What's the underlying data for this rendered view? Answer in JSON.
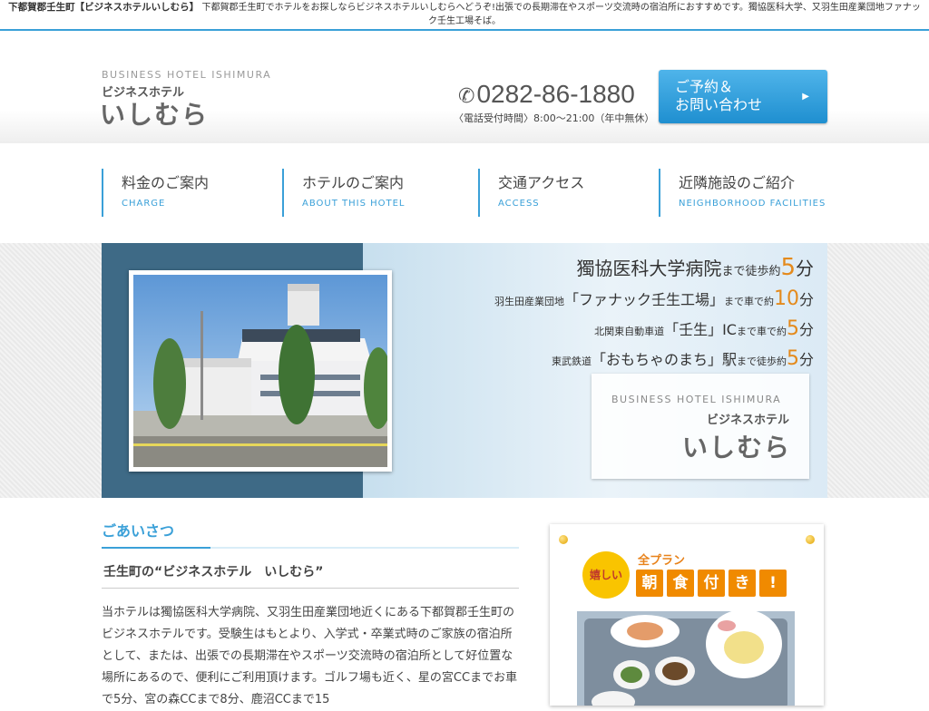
{
  "topbar": {
    "title": "下都賀郡壬生町【ビジネスホテルいしむら】",
    "description": "下都賀郡壬生町でホテルをお探しならビジネスホテルいしむらへどうぞ!出張での長期滞在やスポーツ交流時の宿泊所におすすめです。獨協医科大学、又羽生田産業団地ファナック壬生工場そば。"
  },
  "header": {
    "logo_en": "BUSINESS HOTEL ISHIMURA",
    "logo_jp_small": "ビジネスホテル",
    "logo_jp_big": "いしむら",
    "phone": "0282-86-1880",
    "phone_hours": "〈電話受付時間〉8:00〜21:00（年中無休）",
    "contact_line1": "ご予約＆",
    "contact_line2": "お問い合わせ"
  },
  "nav": {
    "items": [
      {
        "jp": "料金のご案内",
        "en": "CHARGE"
      },
      {
        "jp": "ホテルのご案内",
        "en": "ABOUT THIS HOTEL"
      },
      {
        "jp": "交通アクセス",
        "en": "ACCESS"
      },
      {
        "jp": "近隣施設のご紹介",
        "en": "NEIGHBORHOOD FACILITIES"
      }
    ]
  },
  "hero": {
    "line1_text": "獨協医科大学病院",
    "line1_suffix": "まで徒歩約",
    "line1_num": "5",
    "line1_unit": "分",
    "line2_prefix": "羽生田産業団地",
    "line2_text": "「ファナック壬生工場」",
    "line2_suffix": "まで車で約",
    "line2_num": "10",
    "line2_unit": "分",
    "line3_prefix": "北関東自動車道",
    "line3_text": "「壬生」IC",
    "line3_suffix": "まで車で約",
    "line3_num": "5",
    "line3_unit": "分",
    "line4_prefix": "東武鉄道",
    "line4_text": "「おもちゃのまち」駅",
    "line4_suffix": "まで徒歩約",
    "line4_num": "5",
    "line4_unit": "分",
    "logo_en": "BUSINESS HOTEL ISHIMURA",
    "logo_jp_small": "ビジネスホテル",
    "logo_jp_big": "いしむら"
  },
  "greeting": {
    "title": "ごあいさつ",
    "subtitle": "壬生町の“ビジネスホテル　いしむら”",
    "body": "当ホテルは獨協医科大学病院、又羽生田産業団地近くにある下都賀郡壬生町のビジネスホテルです。受験生はもとより、入学式・卒業式時のご家族の宿泊所として、または、出張での長期滞在やスポーツ交流時の宿泊所として好位置な場所にあるので、便利にご利用頂けます。ゴルフ場も近く、星の宮CCまでお車で5分、宮の森CCまで8分、鹿沼CCまで15"
  },
  "side": {
    "badge": "嬉しい",
    "plan_label": "全プラン",
    "breakfast_chars": [
      "朝",
      "食",
      "付",
      "き",
      "!"
    ]
  },
  "colors": {
    "accent": "#3aa0d8",
    "orange": "#e48a1c"
  }
}
